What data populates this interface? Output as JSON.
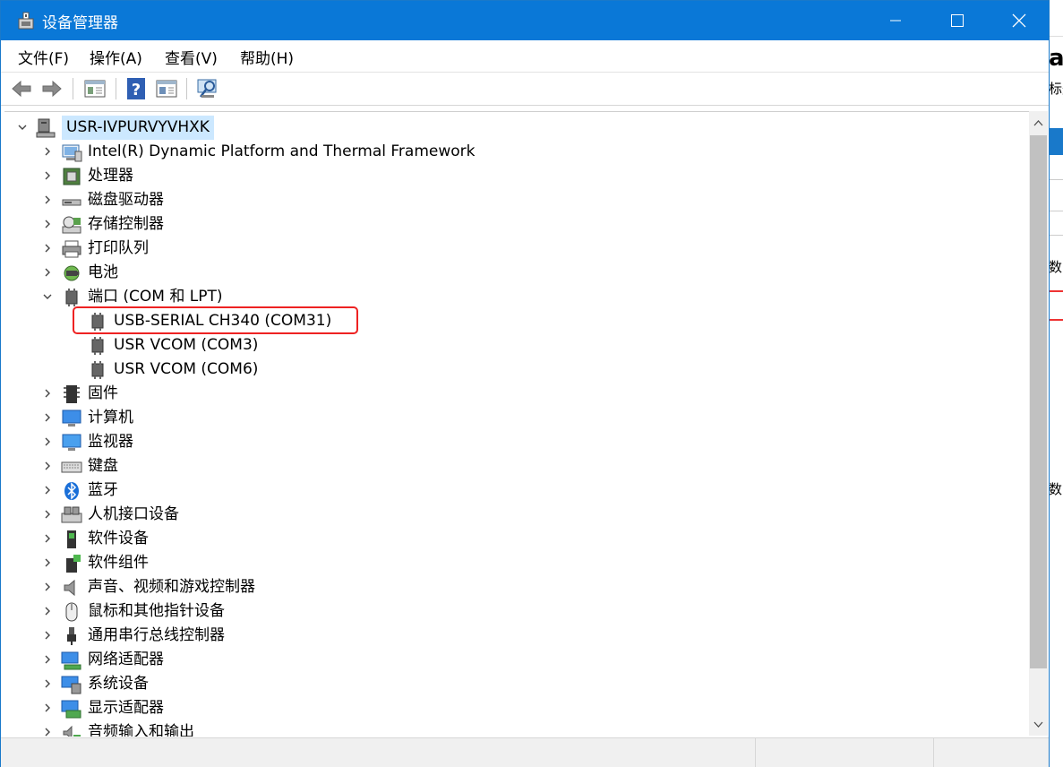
{
  "window": {
    "title": "设备管理器",
    "title_color": "#0a78d7",
    "icon": "device-manager-icon"
  },
  "window_controls": [
    "minimize-icon",
    "maximize-icon",
    "close-icon"
  ],
  "menu": [
    {
      "label": "文件(F)"
    },
    {
      "label": "操作(A)"
    },
    {
      "label": "查看(V)"
    },
    {
      "label": "帮助(H)"
    }
  ],
  "toolbar": [
    "back-arrow-icon",
    "forward-arrow-icon",
    "properties-icon",
    "help-icon",
    "view-pane-icon",
    "scan-hardware-icon"
  ],
  "tree": {
    "root": {
      "label": "USR-IVPURVYVHXK",
      "expanded": true
    },
    "items": [
      {
        "label": "Intel(R) Dynamic Platform and Thermal Framework",
        "icon": "thermal-framework-icon",
        "expanded": false
      },
      {
        "label": "处理器",
        "icon": "processor-icon",
        "expanded": false
      },
      {
        "label": "磁盘驱动器",
        "icon": "disk-drive-icon",
        "expanded": false
      },
      {
        "label": "存储控制器",
        "icon": "storage-controller-icon",
        "expanded": false
      },
      {
        "label": "打印队列",
        "icon": "printer-icon",
        "expanded": false
      },
      {
        "label": "电池",
        "icon": "battery-icon",
        "expanded": false
      },
      {
        "label": "端口 (COM 和 LPT)",
        "icon": "port-icon",
        "expanded": true,
        "children": [
          {
            "label": "USB-SERIAL CH340 (COM31)",
            "icon": "port-icon",
            "highlighted": true
          },
          {
            "label": "USR VCOM (COM3)",
            "icon": "port-icon"
          },
          {
            "label": "USR VCOM (COM6)",
            "icon": "port-icon"
          }
        ]
      },
      {
        "label": "固件",
        "icon": "firmware-icon",
        "expanded": false
      },
      {
        "label": "计算机",
        "icon": "computer-icon",
        "expanded": false
      },
      {
        "label": "监视器",
        "icon": "monitor-icon",
        "expanded": false
      },
      {
        "label": "键盘",
        "icon": "keyboard-icon",
        "expanded": false
      },
      {
        "label": "蓝牙",
        "icon": "bluetooth-icon",
        "expanded": false
      },
      {
        "label": "人机接口设备",
        "icon": "hid-icon",
        "expanded": false
      },
      {
        "label": "软件设备",
        "icon": "software-device-icon",
        "expanded": false
      },
      {
        "label": "软件组件",
        "icon": "software-component-icon",
        "expanded": false
      },
      {
        "label": "声音、视频和游戏控制器",
        "icon": "speaker-icon",
        "expanded": false
      },
      {
        "label": "鼠标和其他指针设备",
        "icon": "mouse-icon",
        "expanded": false
      },
      {
        "label": "通用串行总线控制器",
        "icon": "usb-icon",
        "expanded": false
      },
      {
        "label": "网络适配器",
        "icon": "network-adapter-icon",
        "expanded": false
      },
      {
        "label": "系统设备",
        "icon": "system-device-icon",
        "expanded": false
      },
      {
        "label": "显示适配器",
        "icon": "display-adapter-icon",
        "expanded": false
      },
      {
        "label": "音频输入和输出",
        "icon": "audio-io-icon",
        "expanded": false
      }
    ]
  },
  "highlight_color": "#ee2222",
  "background_window": {
    "texts": [
      "a",
      "标题",
      "数",
      "数"
    ]
  }
}
